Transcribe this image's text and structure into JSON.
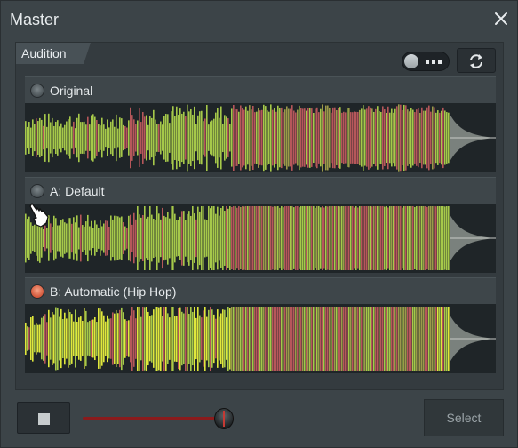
{
  "window": {
    "title": "Master"
  },
  "icons": {
    "close": "close-icon",
    "refresh": "refresh-icon",
    "stop": "stop-icon",
    "cursor": "hand-pointer-icon"
  },
  "audition": {
    "tab_label": "Audition",
    "toggle_on": false,
    "options": [
      {
        "label": "Original",
        "selected": false
      },
      {
        "label": "A: Default",
        "selected": false
      },
      {
        "label": "B: Automatic (Hip Hop)",
        "selected": true
      }
    ]
  },
  "transport": {
    "slider_level": 0.88,
    "select_label": "Select"
  },
  "colors": {
    "accent": "#c43a34",
    "waveform_green": "#a6c94a",
    "waveform_red": "#b6575a",
    "waveform_yellow": "#e0e83c",
    "background": "#3c4448"
  }
}
